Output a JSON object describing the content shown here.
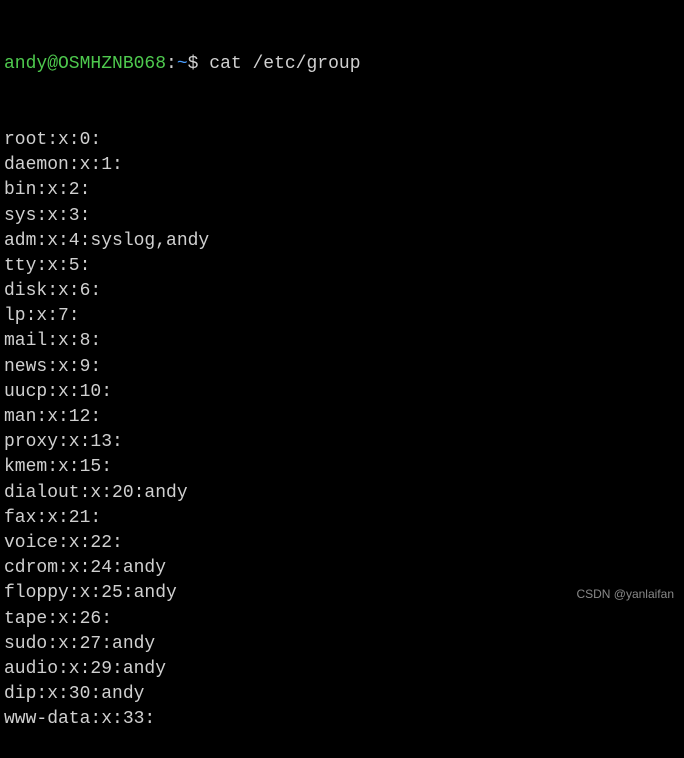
{
  "prompt": {
    "user_host": "andy@OSMHZNB068",
    "separator": ":",
    "path": "~",
    "symbol": "$ "
  },
  "command": "cat /etc/group",
  "output_lines": [
    "root:x:0:",
    "daemon:x:1:",
    "bin:x:2:",
    "sys:x:3:",
    "adm:x:4:syslog,andy",
    "tty:x:5:",
    "disk:x:6:",
    "lp:x:7:",
    "mail:x:8:",
    "news:x:9:",
    "uucp:x:10:",
    "man:x:12:",
    "proxy:x:13:",
    "kmem:x:15:",
    "dialout:x:20:andy",
    "fax:x:21:",
    "voice:x:22:",
    "cdrom:x:24:andy",
    "floppy:x:25:andy",
    "tape:x:26:",
    "sudo:x:27:andy",
    "audio:x:29:andy",
    "dip:x:30:andy",
    "www-data:x:33:"
  ],
  "watermark": "CSDN @yanlaifan"
}
